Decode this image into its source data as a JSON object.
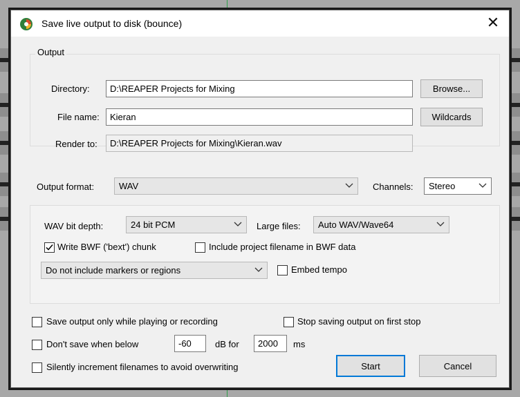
{
  "dialog": {
    "title": "Save live output to disk (bounce)",
    "close_glyph": "✕"
  },
  "output": {
    "group_label": "Output",
    "directory_label": "Directory:",
    "directory_value": "D:\\REAPER Projects for Mixing",
    "browse_label": "Browse...",
    "filename_label": "File name:",
    "filename_value": "Kieran",
    "wildcards_label": "Wildcards",
    "render_to_label": "Render to:",
    "render_to_value": "D:\\REAPER Projects for Mixing\\Kieran.wav"
  },
  "format": {
    "label": "Output format:",
    "value": "WAV",
    "channels_label": "Channels:",
    "channels_value": "Stereo"
  },
  "wav": {
    "bit_depth_label": "WAV bit depth:",
    "bit_depth_value": "24 bit PCM",
    "large_files_label": "Large files:",
    "large_files_value": "Auto WAV/Wave64",
    "write_bwf_label": "Write BWF ('bext') chunk",
    "write_bwf_checked": true,
    "include_project_label": "Include project filename in BWF data",
    "include_project_checked": false,
    "markers_value": "Do not include markers or regions",
    "embed_tempo_label": "Embed tempo",
    "embed_tempo_checked": false
  },
  "options": {
    "save_only_playing_label": "Save output only while playing or recording",
    "stop_first_stop_label": "Stop saving output on first stop",
    "dont_save_below_label": "Don't save when below",
    "threshold_db": "-60",
    "db_for_label": "dB for",
    "duration_ms": "2000",
    "ms_label": "ms",
    "silently_increment_label": "Silently increment filenames to avoid overwriting"
  },
  "buttons": {
    "start_label": "Start",
    "cancel_label": "Cancel"
  },
  "colors": {
    "accent": "#0078d7",
    "dialog_bg": "#f0f0f0"
  },
  "icons": {
    "app": "reaper-logo-icon",
    "dropdown": "chevron-down-icon",
    "check": "check-icon"
  }
}
